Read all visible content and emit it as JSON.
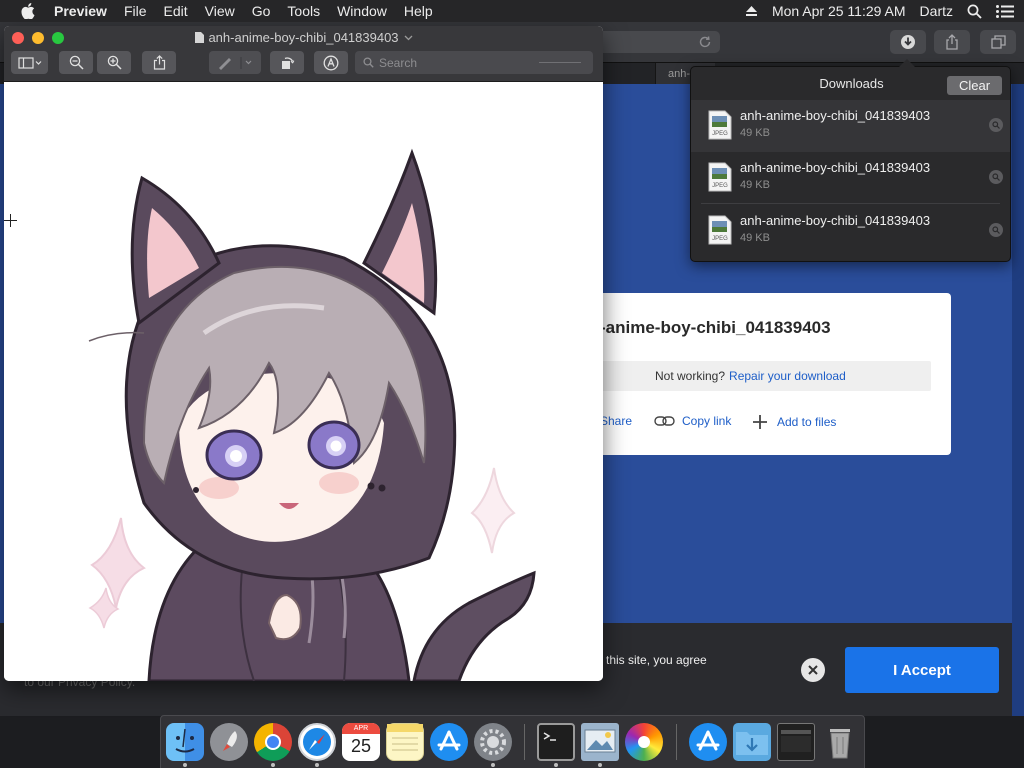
{
  "menubar": {
    "app_name": "Preview",
    "menus": [
      "File",
      "Edit",
      "View",
      "Go",
      "Tools",
      "Window",
      "Help"
    ],
    "clock": "Mon Apr 25  11:29 AM",
    "user": "Dartz"
  },
  "safari": {
    "tab_label": "anh-"
  },
  "card": {
    "filename": "-anime-boy-chibi_041839403",
    "not_working_text": "Not working?",
    "repair_link": "Repair your download",
    "share_label": "Share",
    "copy_link_label": "Copy link",
    "add_to_files_label": "Add to files"
  },
  "consent": {
    "text": "e this site, you agree",
    "text2": "to our Privacy Policy.",
    "accept_label": "I Accept"
  },
  "downloads": {
    "title": "Downloads",
    "clear_label": "Clear",
    "items": [
      {
        "name": "anh-anime-boy-chibi_041839403",
        "size": "49 KB",
        "type": "JPEG"
      },
      {
        "name": "anh-anime-boy-chibi_041839403",
        "size": "49 KB",
        "type": "JPEG"
      },
      {
        "name": "anh-anime-boy-chibi_041839403",
        "size": "49 KB",
        "type": "JPEG"
      }
    ]
  },
  "preview": {
    "window_title": "anh-anime-boy-chibi_041839403",
    "search_placeholder": "Search"
  },
  "dock": {
    "calendar_month": "APR",
    "calendar_day": "25",
    "apps": [
      "Finder",
      "Launchpad",
      "Chrome",
      "Safari",
      "Calendar",
      "Notes",
      "App Store",
      "System Preferences",
      "Terminal",
      "Preview",
      "Photos",
      "App Store Downloads",
      "Downloads Folder",
      "Screen",
      "Trash"
    ]
  }
}
